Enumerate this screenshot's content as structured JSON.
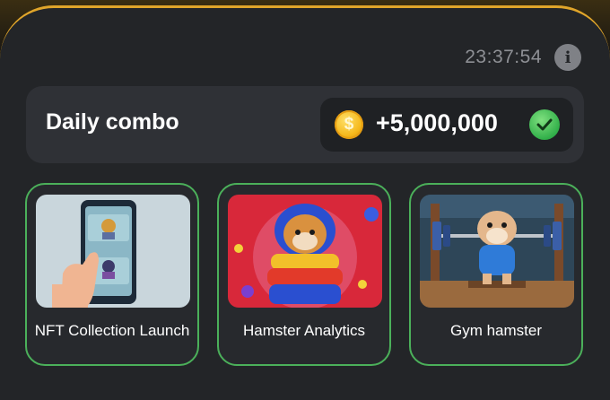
{
  "header": {
    "timer": "23:37:54",
    "info_icon": "info-icon"
  },
  "combo": {
    "title": "Daily combo",
    "reward": "+5,000,000",
    "coin_icon": "coin-icon",
    "status_icon": "checkmark-icon"
  },
  "cards": [
    {
      "label": "NFT Collection Launch",
      "image": "phone-nft-illustration"
    },
    {
      "label": "Hamster Analytics",
      "image": "hamster-puffer-jacket-illustration"
    },
    {
      "label": "Gym hamster",
      "image": "hamster-weightlifting-illustration"
    }
  ],
  "colors": {
    "accent_gold": "#e0a52a",
    "card_border_green": "#4bb05a",
    "panel": "#232528"
  }
}
